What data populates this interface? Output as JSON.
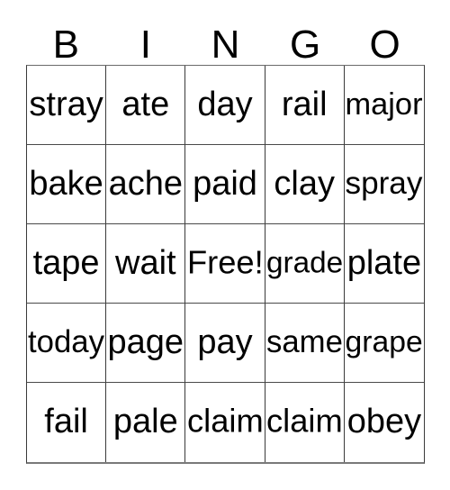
{
  "card": {
    "title_letters": [
      "B",
      "I",
      "N",
      "G",
      "O"
    ],
    "columns": 5,
    "rows": 5,
    "text_color": "#000000",
    "border_color": "#3a3a3a",
    "background_color": "#ffffff",
    "free_space": {
      "label": "Free!",
      "row": 3,
      "column": 3
    },
    "grid": [
      [
        "stray",
        "ate",
        "day",
        "rail",
        "major"
      ],
      [
        "bake",
        "ache",
        "paid",
        "clay",
        "spray"
      ],
      [
        "tape",
        "wait",
        "Free!",
        "grade",
        "plate"
      ],
      [
        "today",
        "page",
        "pay",
        "same",
        "grape"
      ],
      [
        "fail",
        "pale",
        "claim",
        "claim",
        "obey"
      ]
    ]
  }
}
